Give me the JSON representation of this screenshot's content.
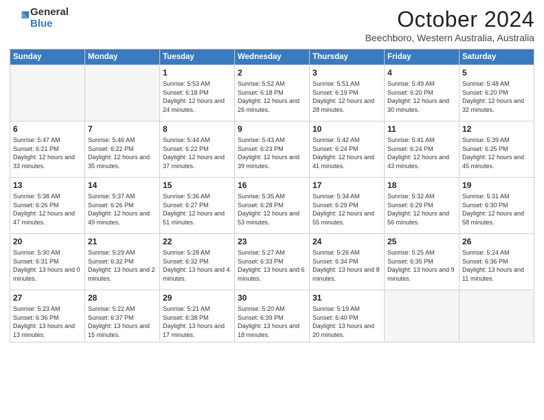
{
  "logo": {
    "general": "General",
    "blue": "Blue"
  },
  "header": {
    "month": "October 2024",
    "location": "Beechboro, Western Australia, Australia"
  },
  "weekdays": [
    "Sunday",
    "Monday",
    "Tuesday",
    "Wednesday",
    "Thursday",
    "Friday",
    "Saturday"
  ],
  "weeks": [
    [
      {
        "day": "",
        "info": ""
      },
      {
        "day": "",
        "info": ""
      },
      {
        "day": "1",
        "info": "Sunrise: 5:53 AM\nSunset: 6:18 PM\nDaylight: 12 hours and 24 minutes."
      },
      {
        "day": "2",
        "info": "Sunrise: 5:52 AM\nSunset: 6:18 PM\nDaylight: 12 hours and 26 minutes."
      },
      {
        "day": "3",
        "info": "Sunrise: 5:51 AM\nSunset: 6:19 PM\nDaylight: 12 hours and 28 minutes."
      },
      {
        "day": "4",
        "info": "Sunrise: 5:49 AM\nSunset: 6:20 PM\nDaylight: 12 hours and 30 minutes."
      },
      {
        "day": "5",
        "info": "Sunrise: 5:48 AM\nSunset: 6:20 PM\nDaylight: 12 hours and 32 minutes."
      }
    ],
    [
      {
        "day": "6",
        "info": "Sunrise: 5:47 AM\nSunset: 6:21 PM\nDaylight: 12 hours and 33 minutes."
      },
      {
        "day": "7",
        "info": "Sunrise: 5:46 AM\nSunset: 6:22 PM\nDaylight: 12 hours and 35 minutes."
      },
      {
        "day": "8",
        "info": "Sunrise: 5:44 AM\nSunset: 6:22 PM\nDaylight: 12 hours and 37 minutes."
      },
      {
        "day": "9",
        "info": "Sunrise: 5:43 AM\nSunset: 6:23 PM\nDaylight: 12 hours and 39 minutes."
      },
      {
        "day": "10",
        "info": "Sunrise: 5:42 AM\nSunset: 6:24 PM\nDaylight: 12 hours and 41 minutes."
      },
      {
        "day": "11",
        "info": "Sunrise: 5:41 AM\nSunset: 6:24 PM\nDaylight: 12 hours and 43 minutes."
      },
      {
        "day": "12",
        "info": "Sunrise: 5:39 AM\nSunset: 6:25 PM\nDaylight: 12 hours and 45 minutes."
      }
    ],
    [
      {
        "day": "13",
        "info": "Sunrise: 5:38 AM\nSunset: 6:26 PM\nDaylight: 12 hours and 47 minutes."
      },
      {
        "day": "14",
        "info": "Sunrise: 5:37 AM\nSunset: 6:26 PM\nDaylight: 12 hours and 49 minutes."
      },
      {
        "day": "15",
        "info": "Sunrise: 5:36 AM\nSunset: 6:27 PM\nDaylight: 12 hours and 51 minutes."
      },
      {
        "day": "16",
        "info": "Sunrise: 5:35 AM\nSunset: 6:28 PM\nDaylight: 12 hours and 53 minutes."
      },
      {
        "day": "17",
        "info": "Sunrise: 5:34 AM\nSunset: 6:29 PM\nDaylight: 12 hours and 55 minutes."
      },
      {
        "day": "18",
        "info": "Sunrise: 5:32 AM\nSunset: 6:29 PM\nDaylight: 12 hours and 56 minutes."
      },
      {
        "day": "19",
        "info": "Sunrise: 5:31 AM\nSunset: 6:30 PM\nDaylight: 12 hours and 58 minutes."
      }
    ],
    [
      {
        "day": "20",
        "info": "Sunrise: 5:30 AM\nSunset: 6:31 PM\nDaylight: 13 hours and 0 minutes."
      },
      {
        "day": "21",
        "info": "Sunrise: 5:29 AM\nSunset: 6:32 PM\nDaylight: 13 hours and 2 minutes."
      },
      {
        "day": "22",
        "info": "Sunrise: 5:28 AM\nSunset: 6:32 PM\nDaylight: 13 hours and 4 minutes."
      },
      {
        "day": "23",
        "info": "Sunrise: 5:27 AM\nSunset: 6:33 PM\nDaylight: 13 hours and 6 minutes."
      },
      {
        "day": "24",
        "info": "Sunrise: 5:26 AM\nSunset: 6:34 PM\nDaylight: 13 hours and 8 minutes."
      },
      {
        "day": "25",
        "info": "Sunrise: 5:25 AM\nSunset: 6:35 PM\nDaylight: 13 hours and 9 minutes."
      },
      {
        "day": "26",
        "info": "Sunrise: 5:24 AM\nSunset: 6:36 PM\nDaylight: 13 hours and 11 minutes."
      }
    ],
    [
      {
        "day": "27",
        "info": "Sunrise: 5:23 AM\nSunset: 6:36 PM\nDaylight: 13 hours and 13 minutes."
      },
      {
        "day": "28",
        "info": "Sunrise: 5:22 AM\nSunset: 6:37 PM\nDaylight: 13 hours and 15 minutes."
      },
      {
        "day": "29",
        "info": "Sunrise: 5:21 AM\nSunset: 6:38 PM\nDaylight: 13 hours and 17 minutes."
      },
      {
        "day": "30",
        "info": "Sunrise: 5:20 AM\nSunset: 6:39 PM\nDaylight: 13 hours and 18 minutes."
      },
      {
        "day": "31",
        "info": "Sunrise: 5:19 AM\nSunset: 6:40 PM\nDaylight: 13 hours and 20 minutes."
      },
      {
        "day": "",
        "info": ""
      },
      {
        "day": "",
        "info": ""
      }
    ]
  ]
}
